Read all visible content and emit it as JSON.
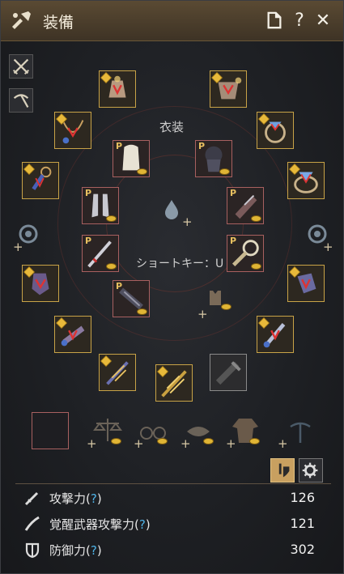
{
  "window": {
    "title": "装備"
  },
  "title_buttons": [
    {
      "name": "document-icon"
    },
    {
      "name": "help",
      "label": "?"
    },
    {
      "name": "close",
      "label": "✕"
    }
  ],
  "center": {
    "costume_label": "衣装",
    "shortcut_label": "ショートキー：U"
  },
  "side_buttons": [
    {
      "name": "swords-icon"
    },
    {
      "name": "pickaxe-icon"
    }
  ],
  "stats": [
    {
      "name": "攻撃力",
      "q": "?",
      "value": "126",
      "icon": "sword-icon"
    },
    {
      "name": "覚醒武器攻撃力",
      "q": "?",
      "value": "121",
      "icon": "blade-icon"
    },
    {
      "name": "防御力",
      "q": "?",
      "value": "302",
      "icon": "shield-icon"
    }
  ],
  "colors": {
    "gold_border": "#c8a347",
    "pearl_border": "#a86060",
    "title_bar": "#4a3d2c",
    "help_blue": "#4fb2e6"
  }
}
